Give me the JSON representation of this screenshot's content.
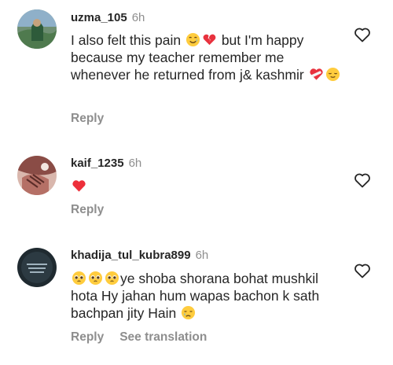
{
  "comments": [
    {
      "username": "uzma_105",
      "time": "6h",
      "text_parts": [
        "I also felt this pain ",
        " but I'm happy because my teacher remember me whenever he returned from j& kashmir "
      ],
      "emojis": [
        "smiling-face-with-tear",
        "broken-heart",
        "mending-heart",
        "relieved-face"
      ],
      "reply": "Reply"
    },
    {
      "username": "kaif_1235",
      "time": "6h",
      "emojis": [
        "red-heart"
      ],
      "reply": "Reply"
    },
    {
      "username": "khadija_tul_kubra899",
      "time": "6h",
      "text_parts": [
        "ye shoba shorana bohat mushkil hota Hy  jahan hum wapas bachon k sath bachpan jity Hain "
      ],
      "emojis": [
        "pleading-face",
        "pleading-face",
        "pleading-face",
        "crying-face"
      ],
      "reply": "Reply",
      "see_translation": "See translation"
    }
  ],
  "colors": {
    "text": "#262626",
    "secondary": "#8e8e8e",
    "heart_red": "#ed2f3a"
  }
}
